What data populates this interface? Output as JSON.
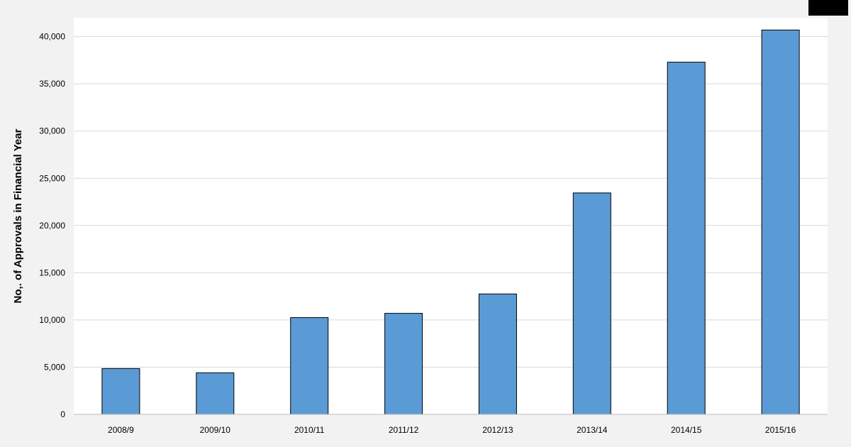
{
  "chart_data": {
    "type": "bar",
    "title": "",
    "xlabel": "",
    "ylabel": "No,. of Approvals in Financial Year",
    "categories": [
      "2008/9",
      "2009/10",
      "2010/11",
      "2011/12",
      "2012/13",
      "2013/14",
      "2014/15",
      "2015/16"
    ],
    "series": [
      {
        "values": [
          4850,
          4400,
          10250,
          10700,
          12750,
          23450,
          37300,
          40700
        ]
      }
    ],
    "ylim": [
      0,
      42000
    ],
    "yticks": [
      0,
      5000,
      10000,
      15000,
      20000,
      25000,
      30000,
      35000,
      40000
    ],
    "ytick_labels": [
      "0",
      "5,000",
      "10,000",
      "15,000",
      "20,000",
      "25,000",
      "30,000",
      "35,000",
      "40,000"
    ],
    "grid": true,
    "legend": "none",
    "colors": {
      "bar_fill": "#5b9bd5",
      "bar_stroke": "#000000",
      "gridline": "#d9d9d9",
      "plot_background": "#ffffff",
      "page_background": "#f2f2f2"
    }
  }
}
